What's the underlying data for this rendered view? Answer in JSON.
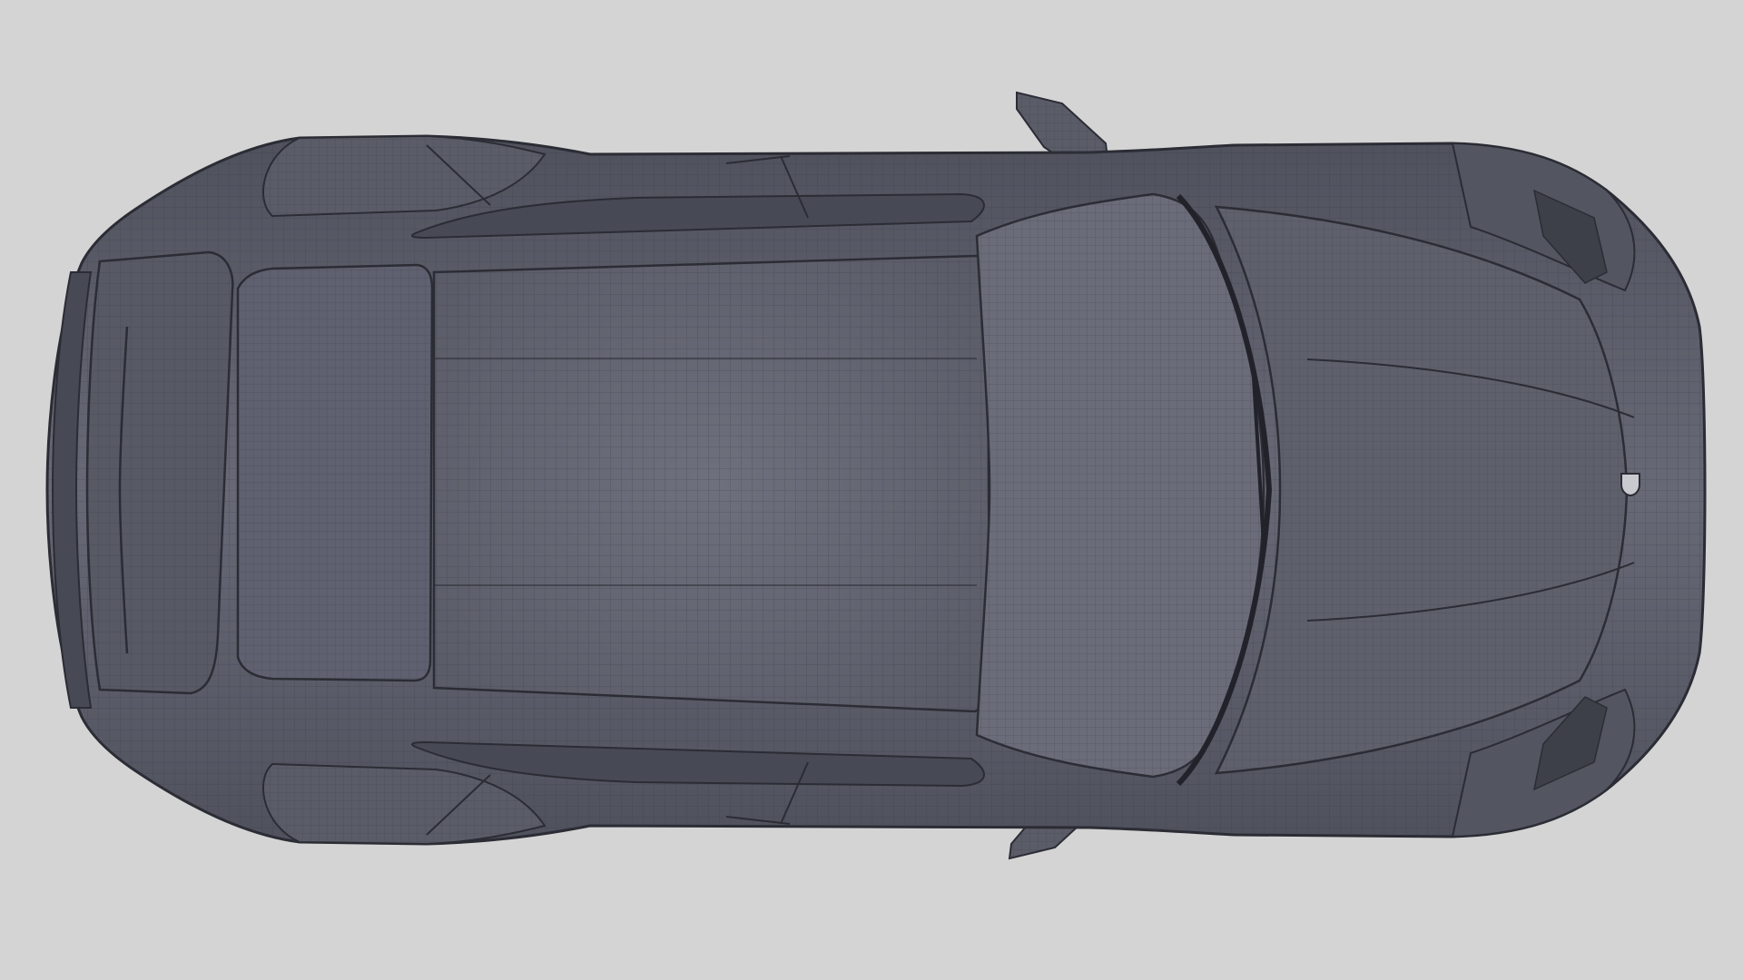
{
  "scene": {
    "subject": "car-wireframe-top-view",
    "colors": {
      "background": "#d4d4d5",
      "body": "#5b5d6a",
      "body_light": "#6d6f7c",
      "body_dark": "#474955",
      "wire": "#3b3d48",
      "outline": "#2b2c34"
    }
  }
}
